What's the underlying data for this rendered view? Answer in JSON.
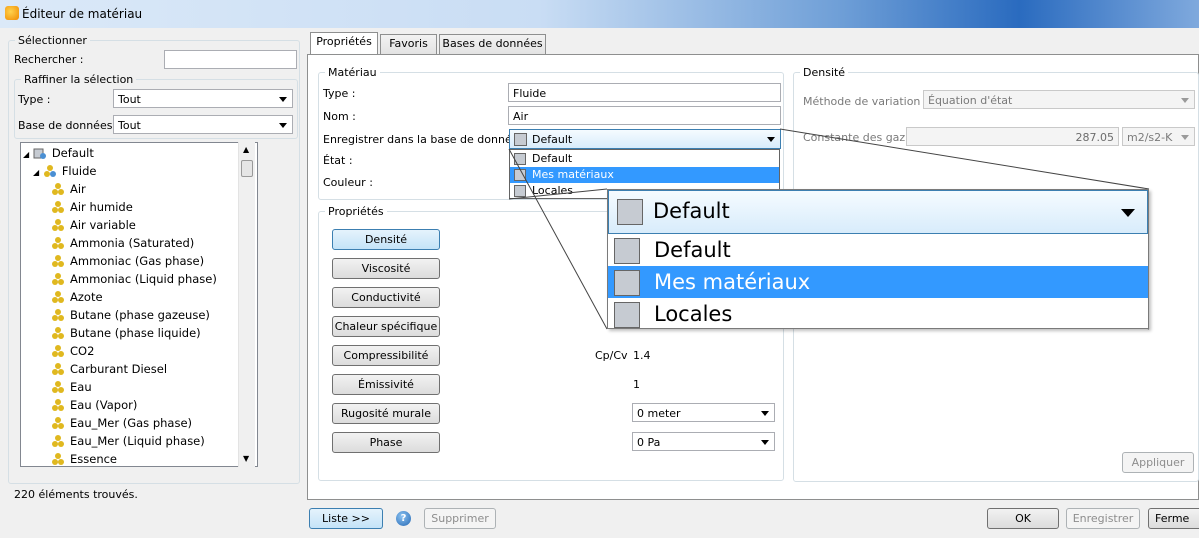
{
  "window": {
    "title": "Éditeur de matériau"
  },
  "left": {
    "select_group": "Sélectionner",
    "search_label": "Rechercher :",
    "search_value": "",
    "refine_group": "Raffiner la sélection",
    "type_label": "Type :",
    "type_value": "Tout",
    "db_label": "Base de données :",
    "db_value": "Tout",
    "tree": {
      "root": "Default",
      "fluid": "Fluide",
      "items": [
        "Air",
        "Air humide",
        "Air variable",
        "Ammonia (Saturated)",
        "Ammoniac (Gas phase)",
        "Ammoniac (Liquid phase)",
        "Azote",
        "Butane (phase gazeuse)",
        "Butane (phase liquide)",
        "CO2",
        "Carburant Diesel",
        "Eau",
        "Eau (Vapor)",
        "Eau_Mer (Gas phase)",
        "Eau_Mer (Liquid phase)",
        "Essence"
      ]
    },
    "count_text": "220 éléments trouvés."
  },
  "tabs": [
    "Propriétés",
    "Favoris",
    "Bases de données"
  ],
  "material": {
    "group": "Matériau",
    "type_label": "Type :",
    "type_value": "Fluide",
    "name_label": "Nom :",
    "name_value": "Air",
    "save_db_label": "Enregistrer dans la base de données :",
    "save_db_value": "Default",
    "state_label": "État :",
    "color_label": "Couleur :",
    "dropdown_options": [
      "Default",
      "Mes matériaux",
      "Locales"
    ],
    "dropdown_highlighted": "Mes matériaux"
  },
  "properties": {
    "group": "Propriétés",
    "buttons": [
      "Densité",
      "Viscosité",
      "Conductivité",
      "Chaleur spécifique",
      "Compressibilité",
      "Émissivité",
      "Rugosité murale",
      "Phase"
    ],
    "selected": "Densité",
    "cpcv_label": "Cp/Cv",
    "cpcv_value": "1.4",
    "emissivity_value": "1",
    "roughness_value": "0 meter",
    "phase_value": "0 Pa"
  },
  "density": {
    "group": "Densité",
    "method_label": "Méthode de variation :",
    "method_value": "Équation d'état",
    "gas_const_label": "Constante des gaz :",
    "gas_const_value": "287.05",
    "gas_const_unit": "m2/s2-K",
    "apply_label": "Appliquer"
  },
  "zoom": {
    "header": "Default",
    "items": [
      "Default",
      "Mes matériaux",
      "Locales"
    ]
  },
  "footer": {
    "list_button": "Liste >>",
    "delete_button": "Supprimer",
    "ok_button": "OK",
    "save_button": "Enregistrer",
    "close_button": "Ferme"
  },
  "colors": {
    "highlight": "#3399ff",
    "accent": "#3c7fb1"
  }
}
